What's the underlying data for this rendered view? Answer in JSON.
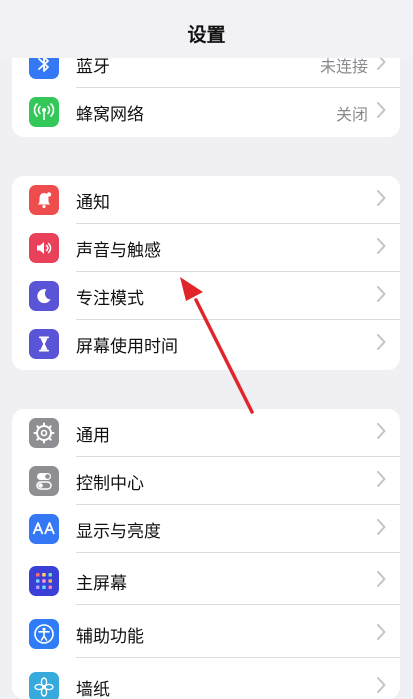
{
  "nav": {
    "title": "设置"
  },
  "group1": [
    {
      "label": "蓝牙",
      "value": "未连接"
    },
    {
      "label": "蜂窝网络",
      "value": "关闭"
    }
  ],
  "group2": [
    {
      "label": "通知"
    },
    {
      "label": "声音与触感"
    },
    {
      "label": "专注模式"
    },
    {
      "label": "屏幕使用时间"
    }
  ],
  "group3": [
    {
      "label": "通用"
    },
    {
      "label": "控制中心"
    },
    {
      "label": "显示与亮度"
    },
    {
      "label": "主屏幕"
    },
    {
      "label": "辅助功能"
    },
    {
      "label": "墙纸"
    }
  ],
  "icons": {
    "bluetooth": "bluetooth-icon",
    "cellular": "cellular-icon",
    "notifications": "notifications-icon",
    "sound": "speaker-icon",
    "focus": "moon-icon",
    "screen_time": "hourglass-icon",
    "general": "gear-icon",
    "control_center": "toggles-icon",
    "display": "display-aa-icon",
    "home_screen": "home-grid-icon",
    "accessibility": "accessibility-icon",
    "wallpaper": "wallpaper-flower-icon"
  },
  "colors": {
    "bluetooth": "#3478f6",
    "cellular": "#34c759",
    "notifications": "#ef4d4d",
    "sound": "#e9415a",
    "focus": "#5a55d6",
    "screen_time": "#5a55d6",
    "general": "#8e8e93",
    "control_center": "#8e8e93",
    "display": "#3478f6",
    "home_screen": "#3a3fd8",
    "accessibility": "#2f7cf6",
    "wallpaper": "#36aadc",
    "annotation_arrow": "#e0262a"
  }
}
